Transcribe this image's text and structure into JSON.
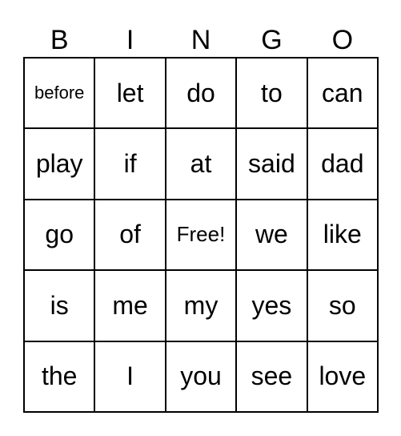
{
  "header": [
    "B",
    "I",
    "N",
    "G",
    "O"
  ],
  "rows": [
    [
      "before",
      "let",
      "do",
      "to",
      "can"
    ],
    [
      "play",
      "if",
      "at",
      "said",
      "dad"
    ],
    [
      "go",
      "of",
      "Free!",
      "we",
      "like"
    ],
    [
      "is",
      "me",
      "my",
      "yes",
      "so"
    ],
    [
      "the",
      "I",
      "you",
      "see",
      "love"
    ]
  ]
}
